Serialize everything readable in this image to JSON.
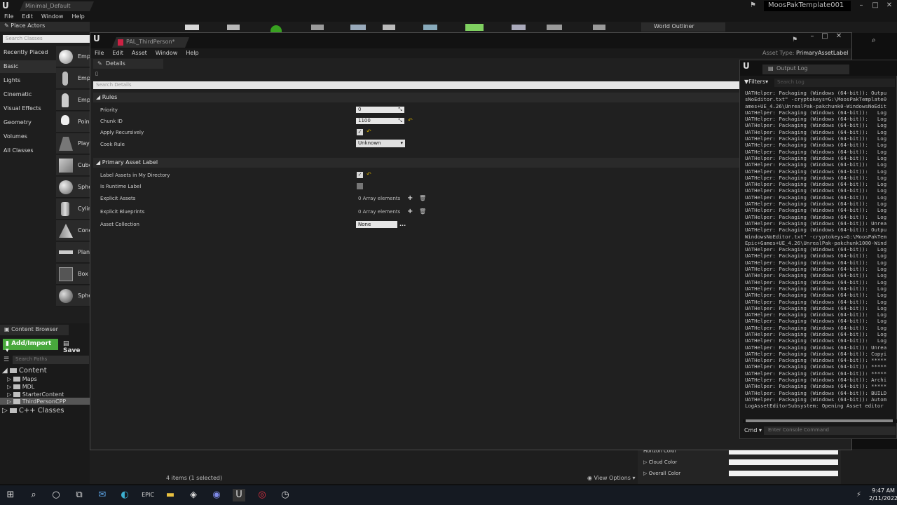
{
  "main_window": {
    "tab": "Minimal_Default",
    "project": "MoosPakTemplate001",
    "menu": [
      "File",
      "Edit",
      "Window",
      "Help"
    ]
  },
  "place_actors": {
    "tab": "Place Actors",
    "search_placeholder": "Search Classes",
    "categories": [
      "Recently Placed",
      "Basic",
      "Lights",
      "Cinematic",
      "Visual Effects",
      "Geometry",
      "Volumes",
      "All Classes"
    ],
    "actors": [
      "Emp",
      "Emp",
      "Emp",
      "Poin",
      "Play",
      "Cube",
      "Sphe",
      "Cylin",
      "Cone",
      "Plan",
      "Box",
      "Sphe"
    ]
  },
  "content_browser": {
    "tab": "Content Browser",
    "add_label": "Add/Import",
    "save_label": "Save",
    "search_placeholder": "Search Paths",
    "root": "Content",
    "folders": [
      "Maps",
      "MDL",
      "StarterContent",
      "ThirdPersonCPP"
    ],
    "cpp": "C++ Classes"
  },
  "world_outliner": {
    "tab": "World Outliner"
  },
  "status": {
    "items": "4 items (1 selected)",
    "view_options": "View Options"
  },
  "world_settings": {
    "rows": [
      "Horizon Color",
      "Cloud Color",
      "Overall Color"
    ]
  },
  "asset_editor": {
    "tab": "PAL_ThirdPerson*",
    "menu": [
      "File",
      "Edit",
      "Asset",
      "Window",
      "Help"
    ],
    "asset_type_label": "Asset Type:",
    "asset_type_value": "PrimaryAssetLabel",
    "details_tab": "Details",
    "search_placeholder": "Search Details",
    "rules": {
      "title": "Rules",
      "priority_label": "Priority",
      "priority_value": "0",
      "chunk_label": "Chunk ID",
      "chunk_value": "1100",
      "apply_recursively_label": "Apply Recursively",
      "cook_rule_label": "Cook Rule",
      "cook_rule_value": "Unknown"
    },
    "primary_label": {
      "title": "Primary Asset Label",
      "label_dir_label": "Label Assets in My Directory",
      "runtime_label": "Is Runtime Label",
      "explicit_assets_label": "Explicit Assets",
      "explicit_assets_value": "0 Array elements",
      "explicit_bp_label": "Explicit Blueprints",
      "explicit_bp_value": "0 Array elements",
      "asset_collection_label": "Asset Collection",
      "asset_collection_value": "None",
      "more": "..."
    }
  },
  "output_log": {
    "tab": "Output Log",
    "filters": "Filters",
    "search_placeholder": "Search Log",
    "cmd_label": "Cmd",
    "cmd_placeholder": "Enter Console Command",
    "lines": [
      "UATHelper: Packaging (Windows (64-bit)): Outpu",
      "sNoEditor.txt\" -cryptokeys=G:\\MoosPakTemplate0",
      "ames+UE_4.26\\UnrealPak-pakchunk0-WindowsNoEdit",
      "UATHelper: Packaging (Windows (64-bit)):   Log",
      "UATHelper: Packaging (Windows (64-bit)):   Log",
      "UATHelper: Packaging (Windows (64-bit)):   Log",
      "UATHelper: Packaging (Windows (64-bit)):   Log",
      "UATHelper: Packaging (Windows (64-bit)):   Log",
      "UATHelper: Packaging (Windows (64-bit)):   Log",
      "UATHelper: Packaging (Windows (64-bit)):   Log",
      "UATHelper: Packaging (Windows (64-bit)):   Log",
      "UATHelper: Packaging (Windows (64-bit)):   Log",
      "UATHelper: Packaging (Windows (64-bit)):   Log",
      "UATHelper: Packaging (Windows (64-bit)):   Log",
      "UATHelper: Packaging (Windows (64-bit)):   Log",
      "UATHelper: Packaging (Windows (64-bit)):   Log",
      "UATHelper: Packaging (Windows (64-bit)):   Log",
      "UATHelper: Packaging (Windows (64-bit)):   Log",
      "UATHelper: Packaging (Windows (64-bit)):   Log",
      "UATHelper: Packaging (Windows (64-bit)):   Log",
      "UATHelper: Packaging (Windows (64-bit)): Unrea",
      "UATHelper: Packaging (Windows (64-bit)): Outpu",
      "WindowsNoEditor.txt\" -cryptokeys=G:\\MoosPakTem",
      "Epic+Games+UE_4.26\\UnrealPak-pakchunk1000-Wind",
      "UATHelper: Packaging (Windows (64-bit)):   Log",
      "UATHelper: Packaging (Windows (64-bit)):   Log",
      "UATHelper: Packaging (Windows (64-bit)):   Log",
      "UATHelper: Packaging (Windows (64-bit)):   Log",
      "UATHelper: Packaging (Windows (64-bit)):   Log",
      "UATHelper: Packaging (Windows (64-bit)):   Log",
      "UATHelper: Packaging (Windows (64-bit)):   Log",
      "UATHelper: Packaging (Windows (64-bit)):   Log",
      "UATHelper: Packaging (Windows (64-bit)):   Log",
      "UATHelper: Packaging (Windows (64-bit)):   Log",
      "UATHelper: Packaging (Windows (64-bit)):   Log",
      "UATHelper: Packaging (Windows (64-bit)):   Log",
      "UATHelper: Packaging (Windows (64-bit)):   Log",
      "UATHelper: Packaging (Windows (64-bit)):   Log",
      "UATHelper: Packaging (Windows (64-bit)):   Log",
      "UATHelper: Packaging (Windows (64-bit)): Unrea",
      "UATHelper: Packaging (Windows (64-bit)): Copyi",
      "UATHelper: Packaging (Windows (64-bit)): *****",
      "UATHelper: Packaging (Windows (64-bit)): *****",
      "UATHelper: Packaging (Windows (64-bit)): *****",
      "UATHelper: Packaging (Windows (64-bit)): Archi",
      "UATHelper: Packaging (Windows (64-bit)): *****",
      "UATHelper: Packaging (Windows (64-bit)): BUILD",
      "UATHelper: Packaging (Windows (64-bit)): Autom",
      "LogAssetEditorSubsystem: Opening Asset editor"
    ]
  },
  "taskbar": {
    "time": "9:47 AM",
    "date": "2/11/2022"
  }
}
